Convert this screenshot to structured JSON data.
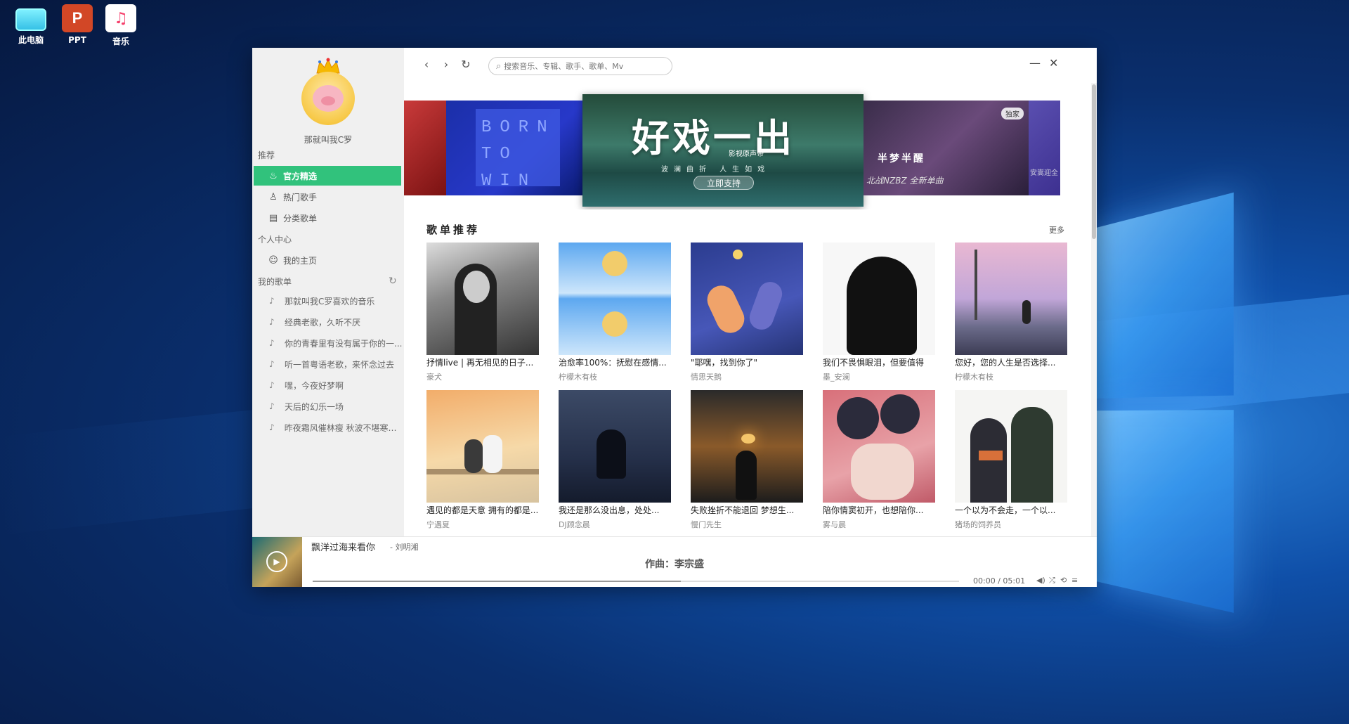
{
  "desktop": {
    "icons": [
      {
        "label": "此电脑",
        "icon": "computer-icon"
      },
      {
        "label": "PPT",
        "icon": "powerpoint-icon"
      },
      {
        "label": "音乐",
        "icon": "music-icon"
      }
    ]
  },
  "sidebar": {
    "user_name": "那就叫我C罗",
    "section_recommend": "推荐",
    "nav": [
      {
        "label": "官方精选",
        "icon": "flame-icon",
        "active": true
      },
      {
        "label": "热门歌手",
        "icon": "person-icon",
        "active": false
      },
      {
        "label": "分类歌单",
        "icon": "book-icon",
        "active": false
      }
    ],
    "section_personal": "个人中心",
    "personal": [
      {
        "label": "我的主页",
        "icon": "smile-icon"
      }
    ],
    "section_playlists": "我的歌单",
    "playlists": [
      "那就叫我C罗喜欢的音乐",
      "经典老歌，久听不厌",
      "你的青春里有没有属于你的一...",
      "听一首粤语老歌，来怀念过去",
      "嘿，今夜好梦啊",
      "天后的幻乐一场",
      "昨夜霜风催林瘦 秋波不堪寒梧冷"
    ]
  },
  "topbar": {
    "search_placeholder": "搜索音乐、专辑、歌手、歌单、Mv"
  },
  "banner": {
    "blue_text": "BORN TO WIN",
    "main_title": "好戏一出",
    "main_tag": "影视原声带",
    "main_sub": "波澜曲折 人生如戏",
    "main_button": "立即支持",
    "purple_title": "半梦半醒",
    "purple_sub": "北战NZBZ  全新单曲",
    "purple_badge": "独家",
    "violet_text": "安嵩迎全"
  },
  "section": {
    "title": "歌单推荐",
    "more": "更多"
  },
  "playlists": [
    {
      "title": "抒情live | 再无相见的日子...",
      "author": "豪犬"
    },
    {
      "title": "治愈率100%：抚慰在感情...",
      "author": "柠檬木有枝"
    },
    {
      "title": "\"耶嘿，找到你了\"",
      "author": "情思天鹅"
    },
    {
      "title": "我们不畏惧眼泪，但要值得",
      "author": "墨_安澜"
    },
    {
      "title": "您好，您的人生是否选择...",
      "author": "柠檬木有枝"
    },
    {
      "title": "遇见的都是天意 拥有的都是...",
      "author": "宁遇夏"
    },
    {
      "title": "我还是那么没出息，处处...",
      "author": "DJ顾念晨"
    },
    {
      "title": "失败挫折不能退回 梦想生...",
      "author": "慢门先生"
    },
    {
      "title": "陪你情窦初开，也想陪你...",
      "author": "雾与晨"
    },
    {
      "title": "一个以为不会走，一个以...",
      "author": "猪场的饲养员"
    }
  ],
  "player": {
    "song": "飘洋过海来看你",
    "artist": "- 刘明湘",
    "lyric": "作曲：李宗盛",
    "time": "00:00 / 05:01",
    "progress": 0.57
  },
  "colors": {
    "accent": "#31c27c",
    "sidebar_bg": "#f0f0f0"
  }
}
